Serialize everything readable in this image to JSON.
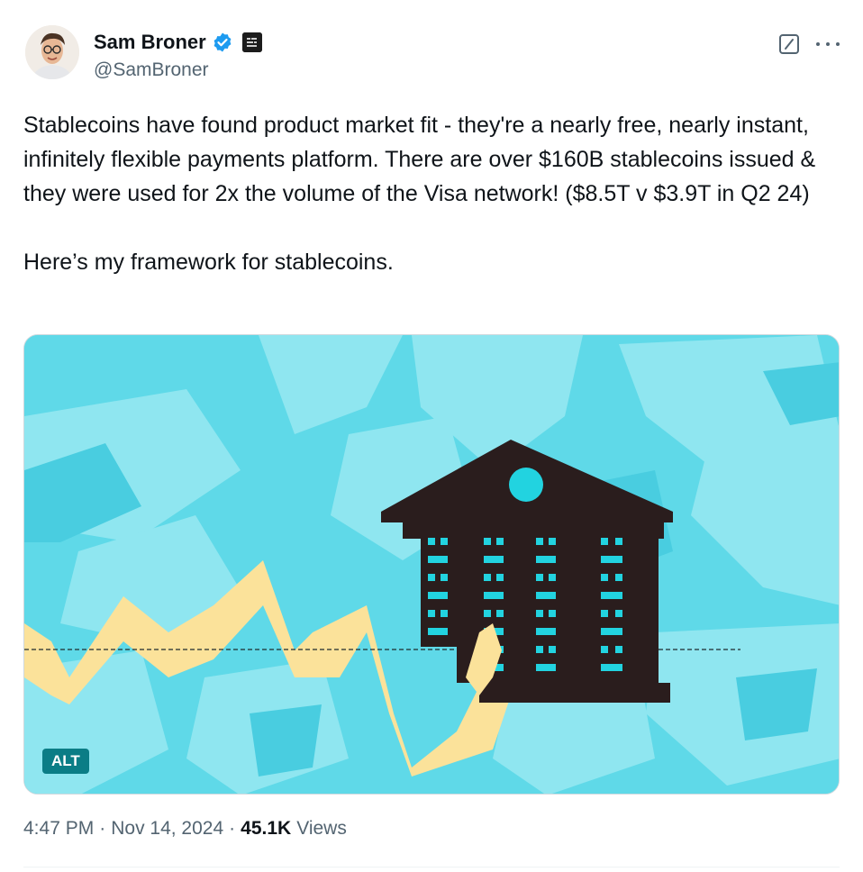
{
  "author": {
    "name": "Sam Broner",
    "handle": "@SamBroner",
    "verified": true,
    "affiliation_badge": "a16z crypto"
  },
  "post": {
    "paragraph1": "Stablecoins have found product market fit - they're a nearly free, nearly instant, infinitely flexible payments platform. There are over $160B stablecoins issued & they were used for 2x the volume of the Visa network! ($8.5T v $3.9T in Q2 24)",
    "paragraph2": "Here’s my framework for stablecoins."
  },
  "media": {
    "alt_label": "ALT",
    "colors": {
      "background": "#5fd9e8",
      "pattern": "#8fe6f0",
      "zigzag": "#fbe29a",
      "bank": "#2a1d1d",
      "accent": "#22d3e0"
    }
  },
  "meta": {
    "time": "4:47 PM",
    "separator1": "·",
    "date": "Nov 14, 2024",
    "separator2": "·",
    "views_count": "45.1K",
    "views_label": "Views"
  },
  "icons": {
    "verified": "verified-badge-icon",
    "grok": "grok-icon",
    "more": "more-options-icon"
  }
}
